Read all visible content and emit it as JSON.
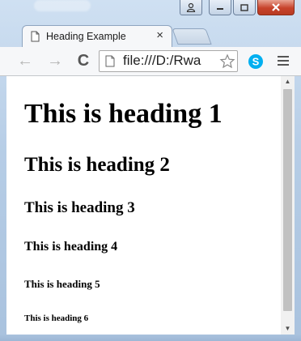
{
  "window": {
    "caption_buttons": {
      "user": "user-icon",
      "minimize": "minimize-icon",
      "maximize": "maximize-icon",
      "close": "close-icon"
    }
  },
  "tab": {
    "title": "Heading Example",
    "close_glyph": "×"
  },
  "toolbar": {
    "back_glyph": "←",
    "forward_glyph": "→",
    "reload_glyph": "C",
    "address": "file:///D:/Rwa"
  },
  "page": {
    "h1": "This is heading 1",
    "h2": "This is heading 2",
    "h3": "This is heading 3",
    "h4": "This is heading 4",
    "h5": "This is heading 5",
    "h6": "This is heading 6"
  },
  "scrollbar": {
    "up_glyph": "▲",
    "down_glyph": "▼"
  },
  "colors": {
    "close_button": "#c7432b",
    "skype": "#00aff0",
    "frame": "#b6cde6"
  }
}
